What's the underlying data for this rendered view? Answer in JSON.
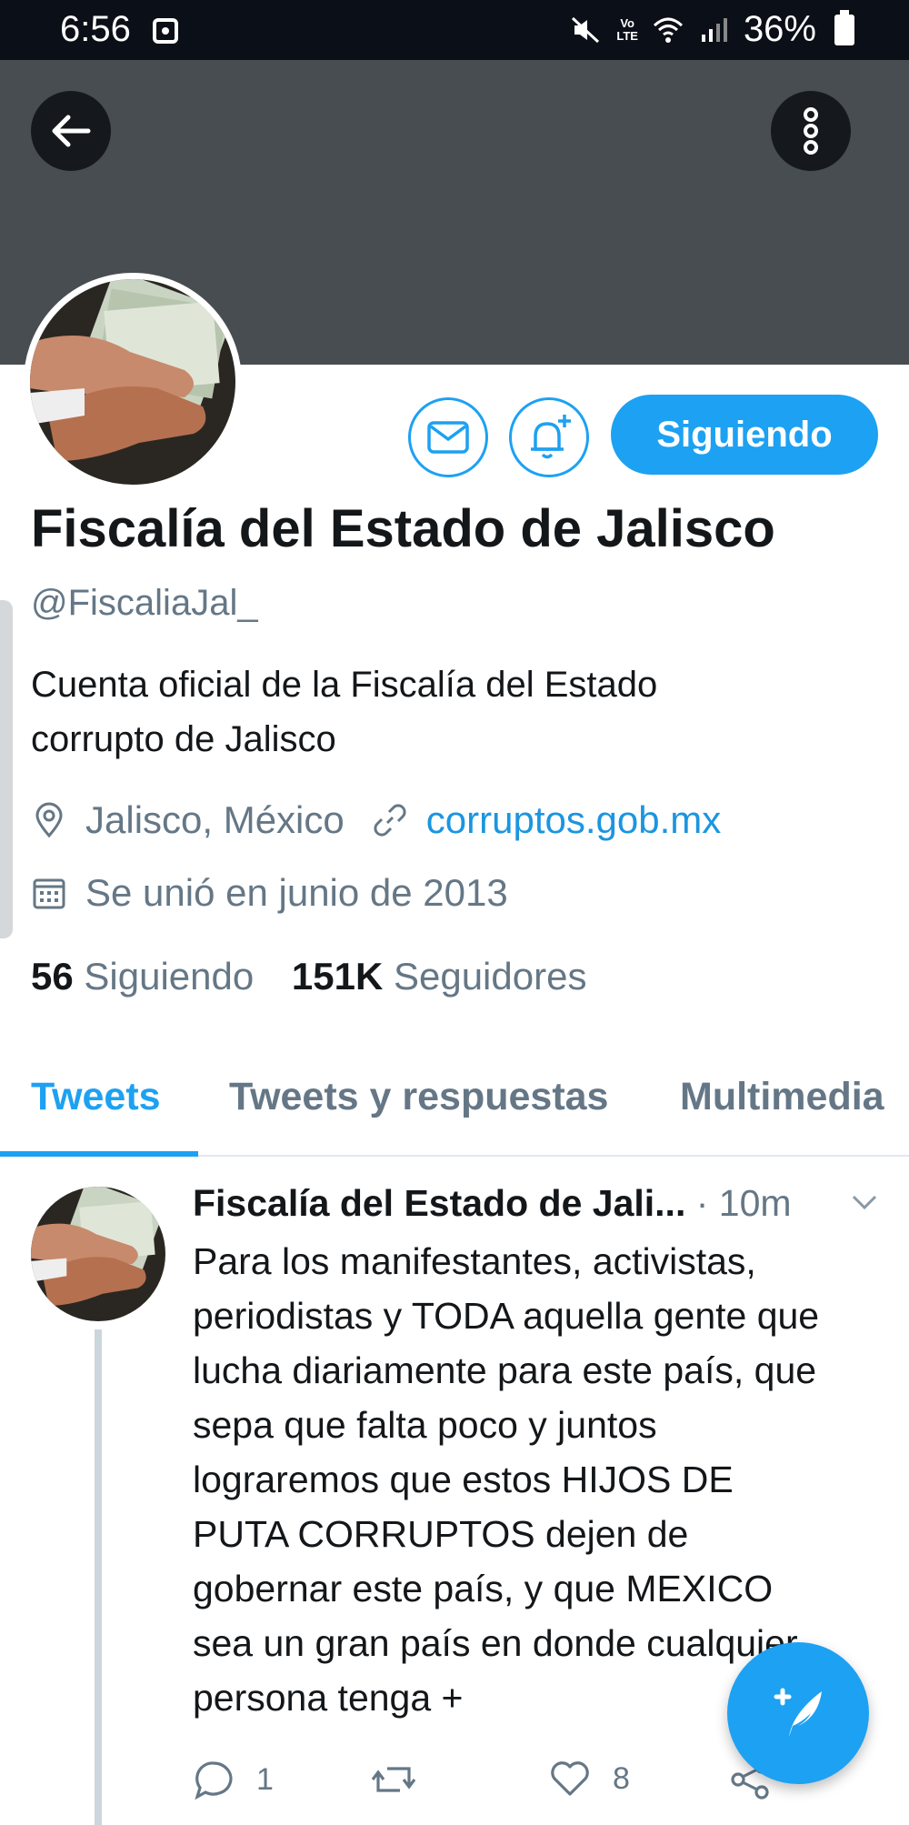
{
  "status_bar": {
    "time": "6:56",
    "lte_top": "Vo",
    "lte_bottom": "LTE",
    "battery": "36%"
  },
  "header": {
    "back_icon": "arrow-left-icon",
    "more_icon": "more-vertical-icon"
  },
  "profile": {
    "follow_button": "Siguiendo",
    "name": "Fiscalía del Estado de Jalisco",
    "handle": "@FiscaliaJal_",
    "bio_lines": [
      "Cuenta oficial de la Fiscalía del Estado",
      "corrupto de Jalisco"
    ],
    "location": "Jalisco, México",
    "website": "corruptos.gob.mx",
    "joined": "Se unió en junio de 2013",
    "following_count": "56",
    "following_label": "Siguiendo",
    "followers_count": "151K",
    "followers_label": "Seguidores"
  },
  "tabs": [
    {
      "label": "Tweets",
      "active": true
    },
    {
      "label": "Tweets y respuestas",
      "active": false
    },
    {
      "label": "Multimedia",
      "active": false
    }
  ],
  "tweet": {
    "author": "Fiscalía del Estado de Jali...",
    "time": "· 10m",
    "text_lines": [
      "Para los manifestantes, activistas,",
      "periodistas y TODA aquella gente que",
      "lucha diariamente para este país, que",
      "sepa que falta poco y juntos",
      "lograremos que estos HIJOS DE",
      "PUTA CORRUPTOS dejen de",
      "gobernar este país, y que MEXICO",
      "sea un gran país en donde cualquier",
      "persona tenga +"
    ],
    "replies": "1",
    "likes": "8"
  },
  "colors": {
    "accent": "#1da1f2",
    "banner": "#474d50",
    "muted": "#657786",
    "link": "#1b95e0"
  }
}
